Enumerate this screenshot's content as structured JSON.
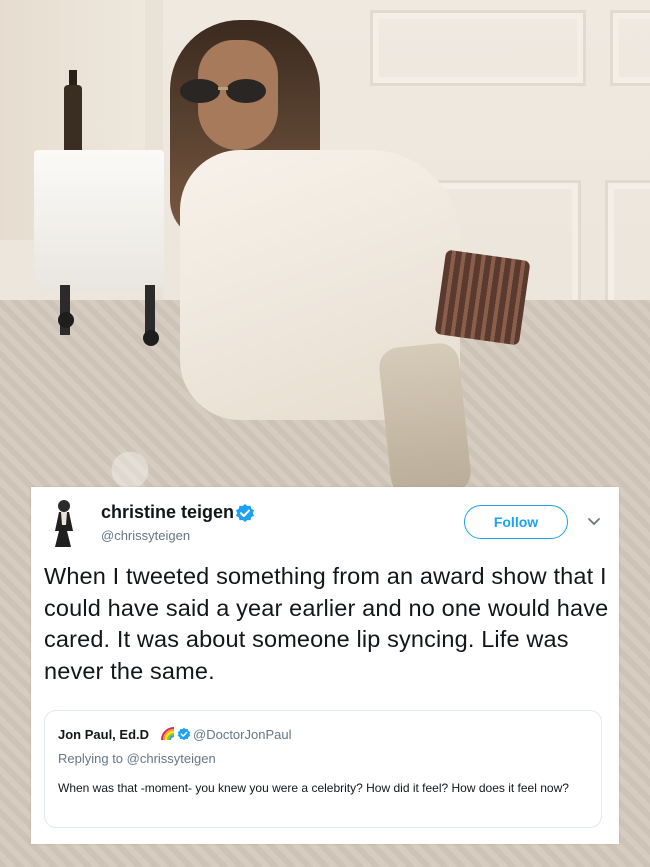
{
  "tweet": {
    "display_name": "christine teigen",
    "handle": "@chrissyteigen",
    "follow_label": "Follow",
    "text": "When I tweeted something from an award show that I could have said a year earlier and no one would have cared. It was about someone lip syncing. Life was never the same.",
    "verified_icon": "verified-badge-icon",
    "menu_icon": "chevron-down-icon"
  },
  "quoted_tweet": {
    "display_name": "Jon Paul, Ed.D",
    "emoji_icon": "rainbow-icon",
    "handle": "@DoctorJonPaul",
    "replying_to": "Replying to @chrissyteigen",
    "text": "When was that -moment- you knew you were a celebrity? How did it feel? How does it feel now?"
  },
  "colors": {
    "accent": "#1da1f2",
    "text": "#14171a",
    "muted": "#657786"
  }
}
